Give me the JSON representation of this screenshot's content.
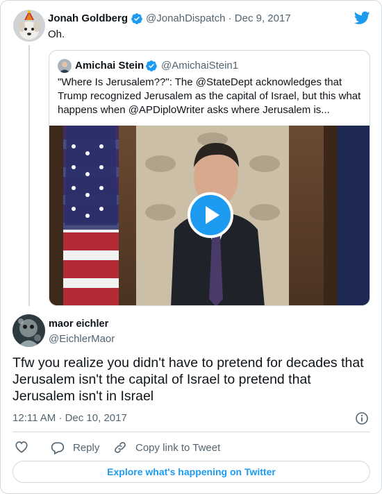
{
  "parent_tweet": {
    "author_name": "Jonah Goldberg",
    "handle_date": "@JonahDispatch · Dec 9, 2017",
    "text": "Oh."
  },
  "quoted_tweet": {
    "author_name": "Amichai Stein",
    "handle": "@AmichaiStein1",
    "text": "\"Where Is Jerusalem??\": The @StateDept acknowledges that Trump recognized Jerusalem as the capital of Israel, but this what happens when @APDiploWriter asks where Jerusalem is..."
  },
  "main_tweet": {
    "author_name": "maor eichler",
    "handle": "@EichlerMaor",
    "text": "Tfw you realize you didn't have to pretend for decades that Jerusalem isn't the capital of Israel to pretend that Jerusalem isn't in Israel",
    "timestamp": "12:11 AM · Dec 10, 2017"
  },
  "actions": {
    "reply_label": "Reply",
    "copy_link_label": "Copy link to Tweet"
  },
  "explore_label": "Explore what's happening on Twitter",
  "icons": {
    "twitter": "twitter-bird-icon",
    "verified": "verified-badge-icon",
    "play": "play-icon",
    "like": "heart-icon",
    "reply": "reply-icon",
    "link": "link-icon",
    "info": "info-icon"
  },
  "colors": {
    "twitter_blue": "#1d9bf0",
    "text_primary": "#0f1419",
    "text_secondary": "#536471",
    "border": "#cfd9de"
  }
}
